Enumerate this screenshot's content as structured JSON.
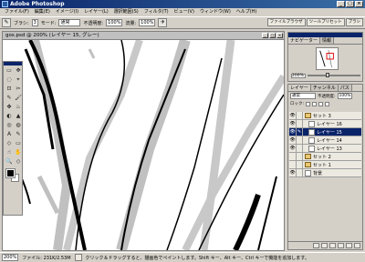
{
  "app": {
    "title": "Adobe Photoshop"
  },
  "window_buttons": {
    "minimize": "_",
    "maximize": "□",
    "close": "×"
  },
  "menu": [
    "ファイル(F)",
    "編集(E)",
    "イメージ(I)",
    "レイヤー(L)",
    "選択範囲(S)",
    "フィルタ(T)",
    "ビュー(V)",
    "ウィンドウ(W)",
    "ヘルプ(H)"
  ],
  "options": {
    "brush_label": "ブラシ:",
    "brush_size": "3",
    "mode_label": "モード:",
    "mode_value": "通常",
    "opacity_label": "不透明度:",
    "opacity_value": "100%",
    "flow_label": "流量:",
    "flow_value": "100%"
  },
  "well_tabs": [
    "ファイルブラウザ",
    "ツールプリセット",
    "ブラシ"
  ],
  "document": {
    "title": "gos.psd @ 200% (レイヤー 15, グレー)"
  },
  "status": {
    "zoom": "200%",
    "file_info": "ファイル: 231K/2.53M",
    "hint": "クリック＆ドラッグすると、描画色でペイントします。Shift キー、Alt キー、Ctrl キーで機能を追加します。"
  },
  "navigator": {
    "tabs": [
      "ナビゲーター",
      "情報"
    ],
    "zoom": "200%",
    "zoom_level": 0.35
  },
  "layers": {
    "tabs": [
      "レイヤー",
      "チャンネル",
      "パス"
    ],
    "mode": "通常",
    "opacity_label": "不透明度:",
    "opacity": "100%",
    "lock_label": "ロック:",
    "items": [
      {
        "name": "セット 3",
        "type": "folder",
        "visible": true,
        "selected": false,
        "indent": 0
      },
      {
        "name": "レイヤー 16",
        "type": "layer",
        "visible": true,
        "selected": false,
        "indent": 1
      },
      {
        "name": "レイヤー 15",
        "type": "layer",
        "visible": true,
        "selected": true,
        "indent": 1
      },
      {
        "name": "レイヤー 14",
        "type": "layer",
        "visible": true,
        "selected": false,
        "indent": 1
      },
      {
        "name": "レイヤー 13",
        "type": "layer",
        "visible": true,
        "selected": false,
        "indent": 1
      },
      {
        "name": "セット 2",
        "type": "folder",
        "visible": false,
        "selected": false,
        "indent": 0
      },
      {
        "name": "セット 1",
        "type": "folder",
        "visible": false,
        "selected": false,
        "indent": 0
      },
      {
        "name": "背景",
        "type": "layer",
        "visible": true,
        "selected": false,
        "indent": 0
      }
    ]
  },
  "tools": [
    "▭",
    "✥",
    "◌",
    "⌖",
    "⊡",
    "✂",
    "✎",
    "🖌",
    "✤",
    "♨",
    "◐",
    "▲",
    "◎",
    "◍",
    "A",
    "✎",
    "◇",
    "▭",
    "☝",
    "✋",
    "🔍",
    "◇"
  ],
  "colors": {
    "foreground": "#000000",
    "background": "#ffffff",
    "titlebar": "#0a246a"
  }
}
